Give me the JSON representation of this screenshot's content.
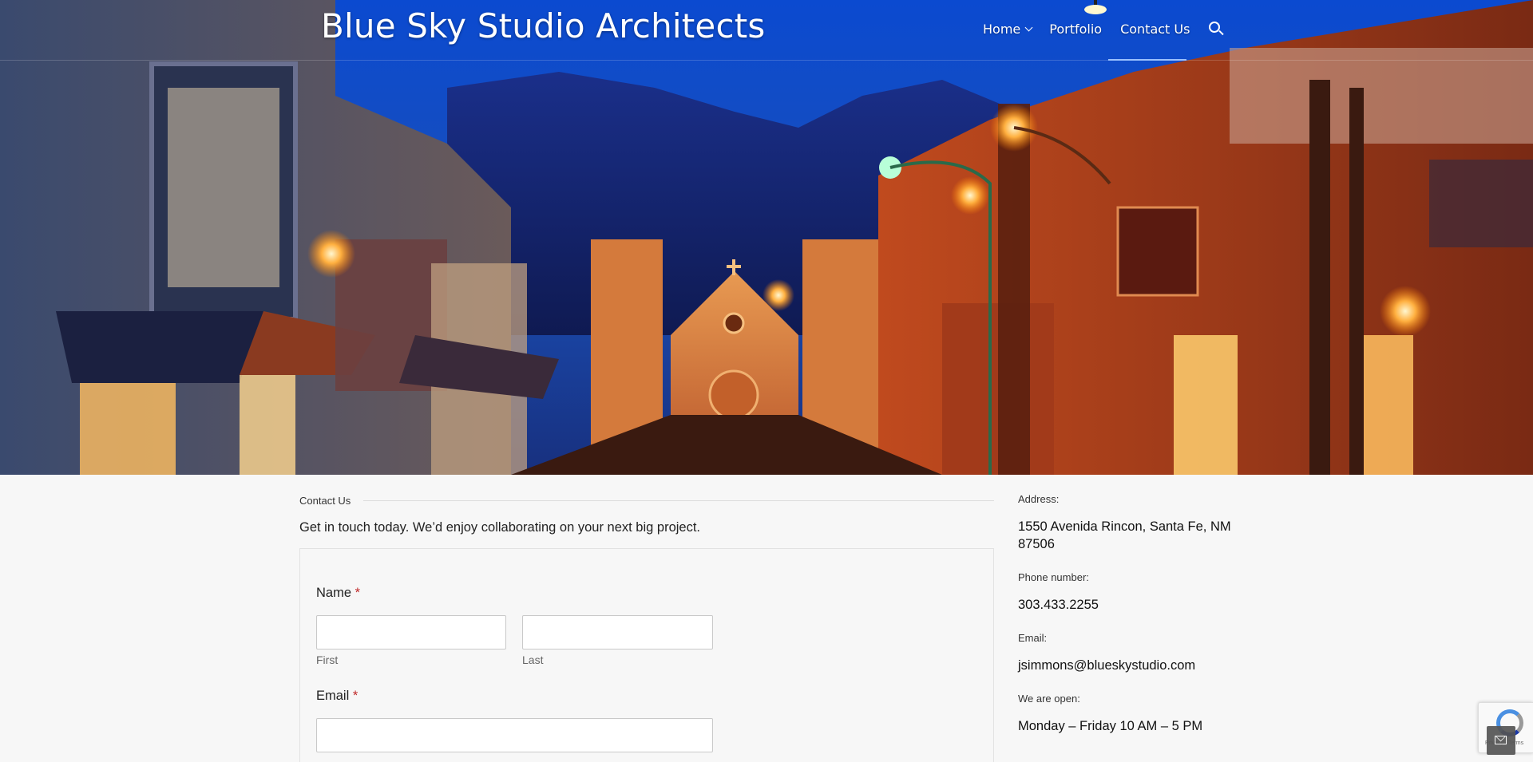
{
  "header": {
    "site_title": "Blue Sky Studio Architects",
    "nav": [
      {
        "label": "Home"
      },
      {
        "label": "Portfolio"
      },
      {
        "label": "Contact Us"
      }
    ]
  },
  "page": {
    "section_label": "Contact Us",
    "intro": "Get in touch today. We’d enjoy collaborating on your next big project."
  },
  "form": {
    "name_label": "Name",
    "email_label": "Email",
    "required_mark": "*",
    "first_sublabel": "First",
    "last_sublabel": "Last",
    "first_value": "",
    "last_value": "",
    "email_value": ""
  },
  "sidebar": {
    "address_label": "Address:",
    "address_value": "1550 Avenida Rincon, Santa Fe, NM 87506",
    "phone_label": "Phone number:",
    "phone_value": "303.433.2255",
    "email_label": "Email:",
    "email_value": "jsimmons@blueskystudio.com",
    "hours_label": "We are open:",
    "hours_value": "Monday – Friday 10 AM – 5 PM"
  },
  "recaptcha": {
    "text": "Privacy - Terms"
  },
  "colors": {
    "accent": "#c02b2b",
    "nav_active_underline": "#9ac0ff"
  }
}
